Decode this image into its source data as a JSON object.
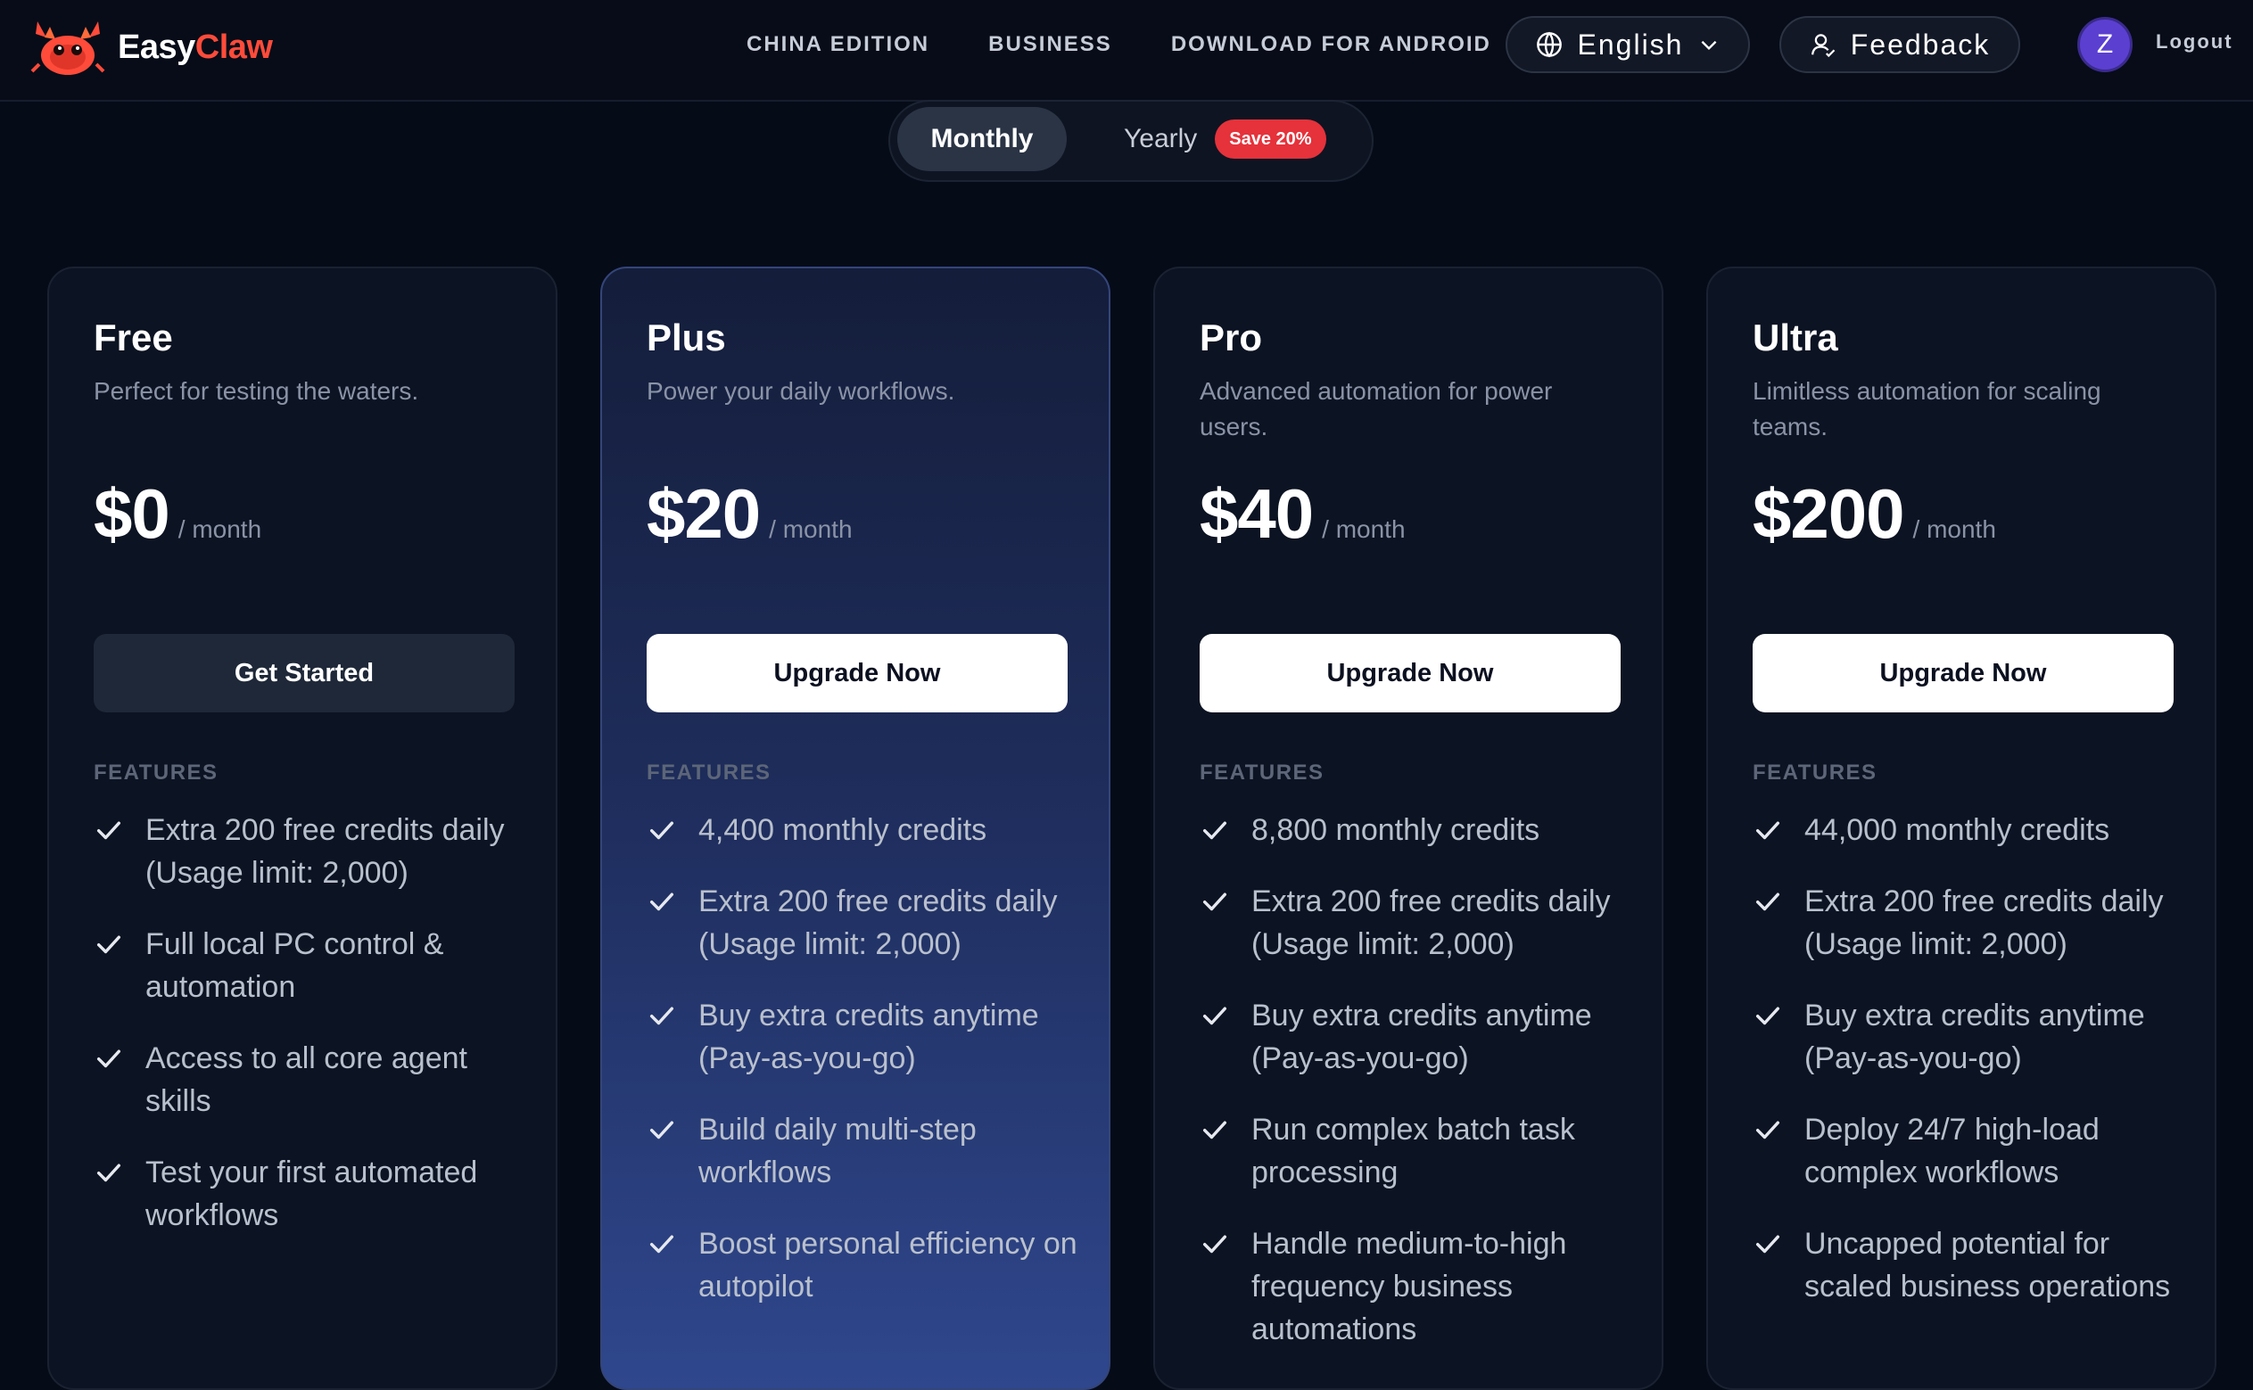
{
  "header": {
    "brand": {
      "part1": "Easy",
      "part2": "Claw"
    },
    "nav": [
      "CHINA EDITION",
      "BUSINESS",
      "DOWNLOAD FOR ANDROID"
    ],
    "language": {
      "label": "English",
      "icon": "globe-icon"
    },
    "feedback": {
      "label": "Feedback",
      "icon": "user-feedback-icon"
    },
    "avatar_initial": "Z",
    "logout": "Logout"
  },
  "billing_toggle": {
    "monthly": "Monthly",
    "yearly": "Yearly",
    "save_badge": "Save 20%",
    "selected": "Monthly"
  },
  "colors": {
    "background": "#060b18",
    "brand_accent": "#ff4b3a",
    "badge_red": "#e5323b",
    "avatar_purple": "#5b3fd1"
  },
  "plans": [
    {
      "name": "Free",
      "description": "Perfect for testing the waters.",
      "price": "$0",
      "period": "/ month",
      "cta": "Get Started",
      "features_heading": "FEATURES",
      "features": [
        "Extra 200 free credits daily (Usage limit: 2,000)",
        "Full local PC control & automation",
        "Access to all core agent skills",
        "Test your first automated workflows"
      ]
    },
    {
      "name": "Plus",
      "description": "Power your daily workflows.",
      "price": "$20",
      "period": "/ month",
      "cta": "Upgrade Now",
      "features_heading": "FEATURES",
      "features": [
        "4,400 monthly credits",
        "Extra 200 free credits daily (Usage limit: 2,000)",
        "Buy extra credits anytime (Pay-as-you-go)",
        "Build daily multi-step workflows",
        "Boost personal efficiency on autopilot"
      ]
    },
    {
      "name": "Pro",
      "description": "Advanced automation for power users.",
      "price": "$40",
      "period": "/ month",
      "cta": "Upgrade Now",
      "features_heading": "FEATURES",
      "features": [
        "8,800 monthly credits",
        "Extra 200 free credits daily (Usage limit: 2,000)",
        "Buy extra credits anytime (Pay-as-you-go)",
        "Run complex batch task processing",
        "Handle medium-to-high frequency business automations"
      ]
    },
    {
      "name": "Ultra",
      "description": "Limitless automation for scaling teams.",
      "price": "$200",
      "period": "/ month",
      "cta": "Upgrade Now",
      "features_heading": "FEATURES",
      "features": [
        "44,000 monthly credits",
        "Extra 200 free credits daily (Usage limit: 2,000)",
        "Buy extra credits anytime (Pay-as-you-go)",
        "Deploy 24/7 high-load complex workflows",
        "Uncapped potential for scaled business operations"
      ]
    }
  ]
}
